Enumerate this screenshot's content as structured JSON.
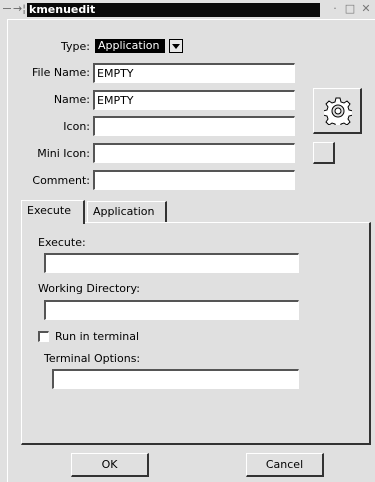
{
  "window": {
    "title": "kmenuedit",
    "pin_glyph": "→¦",
    "minimize_glyph": "·",
    "maximize_glyph": "□",
    "close_glyph": "✕"
  },
  "form": {
    "type_label": "Type:",
    "type_value": "Application",
    "file_name_label": "File Name:",
    "file_name_value": "EMPTY",
    "name_label": "Name:",
    "name_value": "EMPTY",
    "icon_label": "Icon:",
    "icon_value": "",
    "mini_icon_label": "Mini Icon:",
    "mini_icon_value": "",
    "comment_label": "Comment:",
    "comment_value": ""
  },
  "tabs": [
    {
      "label": "Execute",
      "active": true
    },
    {
      "label": "Application",
      "active": false
    }
  ],
  "execute_tab": {
    "execute_label": "Execute:",
    "execute_value": "",
    "working_dir_label": "Working Directory:",
    "working_dir_value": "",
    "run_in_terminal_label": "Run in terminal",
    "run_in_terminal_checked": false,
    "terminal_options_label": "Terminal Options:",
    "terminal_options_value": ""
  },
  "buttons": {
    "ok": "OK",
    "cancel": "Cancel"
  },
  "icons": {
    "app_icon": "gear-icon"
  }
}
